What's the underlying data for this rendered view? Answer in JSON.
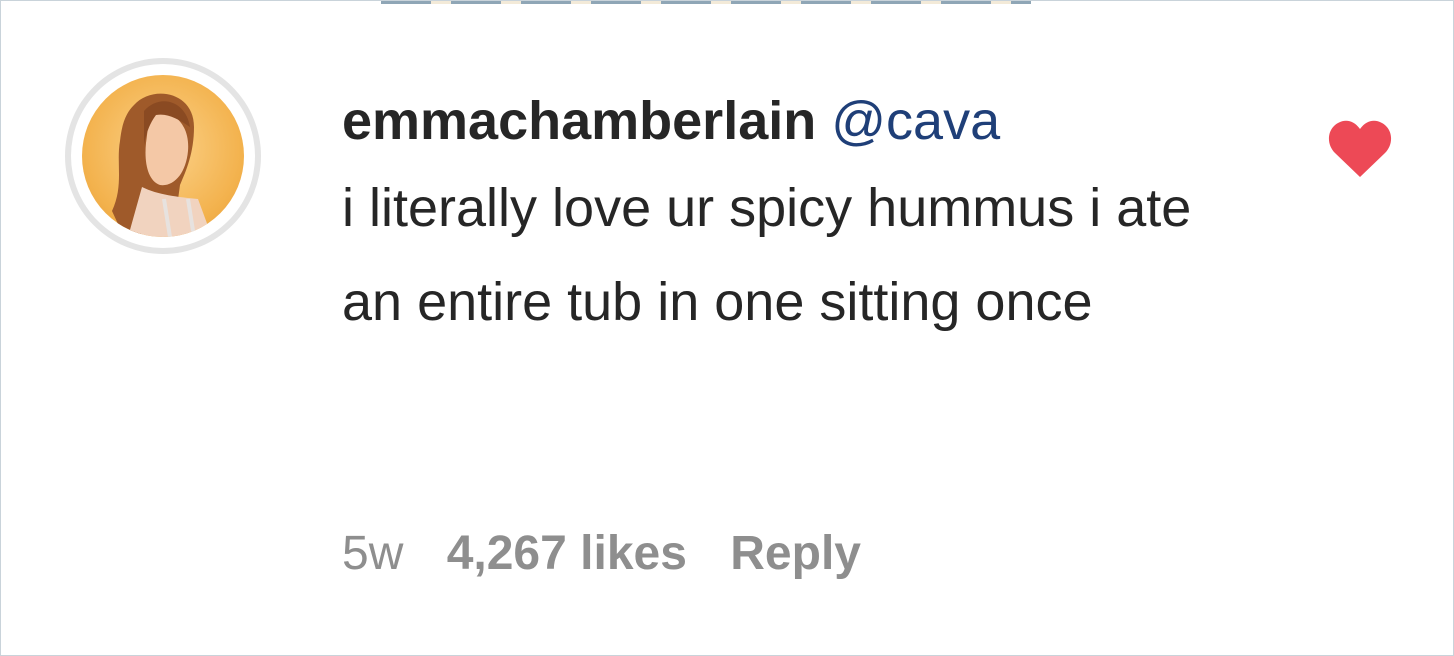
{
  "comment": {
    "username": "emmachamberlain",
    "mention": "@cava",
    "text": "i literally love ur spicy hummus i ate an entire tub in one sitting once",
    "age": "5w",
    "likes": "4,267 likes",
    "reply_label": "Reply",
    "liked": true
  },
  "colors": {
    "heart": "#ed4956",
    "mention": "#1f3f78",
    "meta": "#8e8e8e"
  },
  "icons": {
    "like": "heart-icon",
    "avatar": "profile-avatar"
  }
}
